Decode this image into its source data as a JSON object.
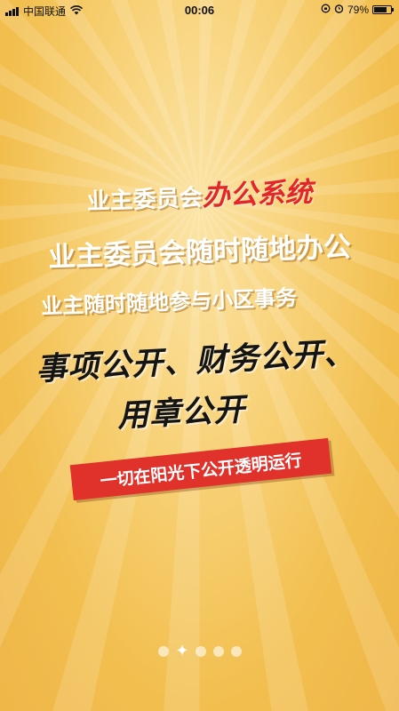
{
  "status_bar": {
    "carrier": "中国联通",
    "time": "00:06",
    "battery": "79%",
    "battery_level": 0.79
  },
  "hero": {
    "line1_prefix": "业主委员会",
    "line1_highlight": "办公系统",
    "line2": "业主委员会随时随地办公",
    "line3": "业主随时随地参与小区事务",
    "line4": "事项公开、财务公开、",
    "line5": "用章公开",
    "banner": "一切在阳光下公开透明运行"
  },
  "pager": {
    "count": 5,
    "active_index": 1,
    "active_glyph": "✦"
  },
  "colors": {
    "background": "#f4c35a",
    "accent_red": "#e0312b",
    "headline_text": "#141414"
  }
}
